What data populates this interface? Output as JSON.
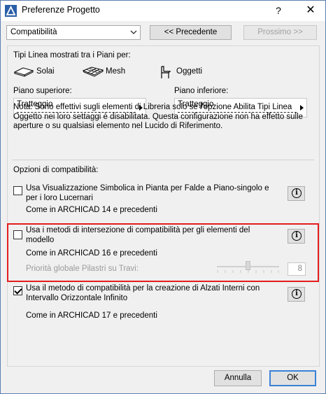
{
  "window": {
    "title": "Preferenze Progetto",
    "help_label": "?",
    "close_label": "✕"
  },
  "toolbar": {
    "dropdown_value": "Compatibilità",
    "prev_label": "<< Precedente",
    "next_label": "Prossimo >>"
  },
  "line_types": {
    "heading": "Tipi Linea mostrati tra i Piani per:",
    "items": [
      {
        "label": "Solai",
        "icon": "slab-icon"
      },
      {
        "label": "Mesh",
        "icon": "mesh-icon"
      },
      {
        "label": "Oggetti",
        "icon": "chair-icon"
      }
    ],
    "upper_label": "Piano superiore:",
    "upper_value": "Tratteggio",
    "lower_label": "Piano inferiore:",
    "lower_value": "Tratteggio",
    "note": "Nota: Sono effettivi sugli elementi di Libreria solo se l'opzione Abilita Tipi Linea Oggetto nei loro settaggi è disabilitata. Questa configurazione non ha effetto sulle aperture o su qualsiasi elemento nel Lucido di Riferimento."
  },
  "compat": {
    "heading": "Opzioni di compatibilità:",
    "options": [
      {
        "label": "Usa Visualizzazione Simbolica in Pianta per Falde a Piano-singolo e per i loro Lucernari",
        "sub": "Come in ARCHICAD 14 e precedenti",
        "checked": false
      },
      {
        "label": "Usa i metodi di intersezione di compatibilità per gli elementi del modello",
        "sub": "Come in ARCHICAD 16 e precedenti",
        "checked": false
      },
      {
        "label": "Usa il metodo di compatibilità per la creazione di Alzati Interni con Intervallo Orizzontale Infinito",
        "sub": "Come in ARCHICAD 17 e precedenti",
        "checked": true
      }
    ],
    "priority_label": "Priorità globale Pilastri su Travi:",
    "priority_value": "8",
    "priority_fraction": 0.5,
    "info_label": "i"
  },
  "footer": {
    "cancel_label": "Annulla",
    "ok_label": "OK"
  },
  "colors": {
    "highlight": "#e31d1d",
    "ok_border": "#3b82d6"
  }
}
